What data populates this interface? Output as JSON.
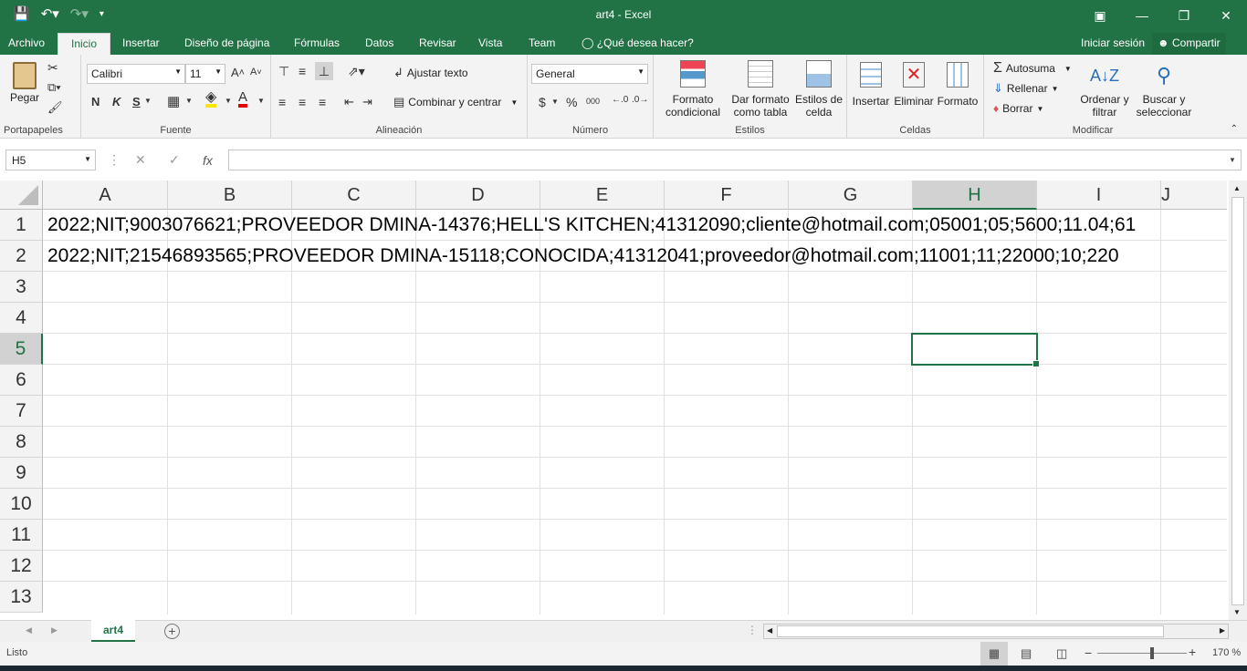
{
  "window": {
    "title": "art4 - Excel"
  },
  "ribbon_tabs": [
    "Archivo",
    "Inicio",
    "Insertar",
    "Diseño de página",
    "Fórmulas",
    "Datos",
    "Revisar",
    "Vista",
    "Team"
  ],
  "tell_me": "¿Qué desea hacer?",
  "account": {
    "sign_in": "Iniciar sesión",
    "share": "Compartir"
  },
  "groups": {
    "clipboard": {
      "label": "Portapapeles",
      "paste": "Pegar"
    },
    "font": {
      "label": "Fuente",
      "font_name": "Calibri",
      "font_size": "11",
      "bold": "N",
      "italic": "K",
      "underline": "S"
    },
    "alignment": {
      "label": "Alineación",
      "wrap": "Ajustar texto",
      "merge": "Combinar y centrar"
    },
    "number": {
      "label": "Número",
      "format": "General",
      "currency": "$",
      "percent": "%",
      "thousands": "000"
    },
    "styles": {
      "label": "Estilos",
      "conditional_1": "Formato",
      "conditional_2": "condicional",
      "table_1": "Dar formato",
      "table_2": "como tabla",
      "cell_1": "Estilos de",
      "cell_2": "celda"
    },
    "cells": {
      "label": "Celdas",
      "insert": "Insertar",
      "delete": "Eliminar",
      "format": "Formato"
    },
    "editing": {
      "label": "Modificar",
      "autosum": "Autosuma",
      "fill": "Rellenar",
      "clear": "Borrar",
      "sort_1": "Ordenar y",
      "sort_2": "filtrar",
      "find_1": "Buscar y",
      "find_2": "seleccionar"
    }
  },
  "formula_bar": {
    "name_box": "H5",
    "fx": "fx",
    "value": ""
  },
  "columns": [
    "A",
    "B",
    "C",
    "D",
    "E",
    "F",
    "G",
    "H",
    "I",
    "J"
  ],
  "rows": [
    "1",
    "2",
    "3",
    "4",
    "5",
    "6",
    "7",
    "8",
    "9",
    "10",
    "11",
    "12",
    "13"
  ],
  "cells": {
    "A1": "2022;NIT;9003076621;PROVEEDOR DMINA-14376;HELL'S KITCHEN;41312090;cliente@hotmail.com;05001;05;5600;11.04;61",
    "A2": "2022;NIT;21546893565;PROVEEDOR DMINA-15118;CONOCIDA;41312041;proveedor@hotmail.com;11001;11;22000;10;220"
  },
  "sheet_tab": "art4",
  "status": {
    "ready": "Listo",
    "zoom": "170 %"
  },
  "colors": {
    "accent": "#217346"
  }
}
